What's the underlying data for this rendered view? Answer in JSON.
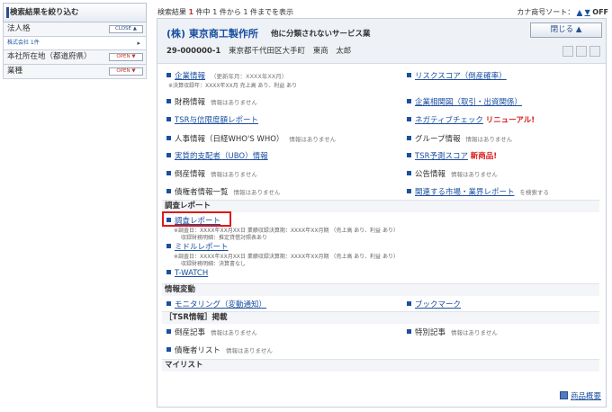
{
  "filter": {
    "title": "検索結果を絞り込む",
    "rows": [
      {
        "label": "法人格",
        "btn": "CLOSE ▲"
      },
      {
        "label": "本社所在地（都道府県）",
        "btn": "OPEN ▼"
      },
      {
        "label": "業種",
        "btn": "OPEN ▼"
      }
    ],
    "sub": {
      "label": "株式会社 1件",
      "arrow": "▸"
    }
  },
  "results": {
    "prefix": "検索結果",
    "count": "1",
    "suffix": "件中 1 件から 1 件までを表示"
  },
  "sort": {
    "label": "カナ商号ソート：",
    "up": "▲",
    "down": "▼",
    "state": "OFF"
  },
  "company": {
    "name": "(株) 東京商工製作所",
    "tag": "他に分類されないサービス業",
    "code": "29-000000-1",
    "address": "東京都千代田区大手町",
    "rep": "東商　太郎",
    "close_label": "閉じる ▲"
  },
  "items": {
    "kigyo_joho": "企業情報",
    "kigyo_note": "（更新年月：XXXX年XX月）",
    "kigyo_sub": "※決算収録年：XXXX年XX月 売上高 あり、利益 あり",
    "risk_score": "リスクスコア（倒産確率）",
    "zaimu": "財務情報",
    "soukan": "企業相関図（取引・出資関係）",
    "tsr_ruiji": "TSR与信限度額レポート",
    "nega": "ネガティブチェック",
    "renewal": "リニューアル!",
    "jinji": "人事情報（日経WHO'S WHO）",
    "group": "グループ情報",
    "ubo": "実質的支配者（UBO）情報",
    "tsr_yosoku": "TSR予測スコア",
    "shinshohin": "新商品!",
    "tosan": "倒産情報",
    "kokoku": "公告情報",
    "saikensha": "債権者情報一覧",
    "kanren": "関連する市場・業界レポート",
    "kanren_note": "を検索する",
    "none": "情報はありません"
  },
  "sections": {
    "chosa": "調査レポート",
    "johohendo": "情報変動",
    "tsr_keisai": "［TSR情報］掲載",
    "mylist": "マイリスト"
  },
  "chosa": {
    "report": "調査レポート",
    "report_note1": "※調査日：XXXX年XX月XX日 業績収録決算期：XXXX年XX月期 （売上高 あり、利益 あり）",
    "report_note2": "収録財務明細：推定貸借対照表あり",
    "middle": "ミドルレポート",
    "middle_note1": "※調査日：XXXX年XX月XX日 業績収録決算期：XXXX年XX月期 （売上高 あり、利益 あり）",
    "middle_note2": "収録財務明細：決算書なし",
    "twatch": "T-WATCH"
  },
  "hendo": {
    "monitoring": "モニタリング（変動通知）",
    "bookmark": "ブックマーク"
  },
  "keisai": {
    "tosan_kiji": "倒産記事",
    "tokubetsu": "特別記事",
    "saiken_list": "債権者リスト"
  },
  "footer": {
    "shohin": "商品概要"
  }
}
